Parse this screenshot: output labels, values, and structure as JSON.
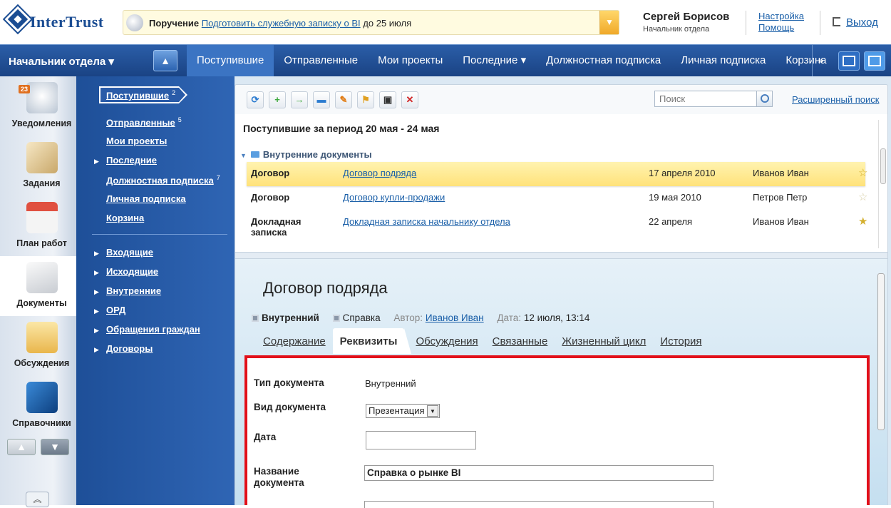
{
  "logo": {
    "text": "InterTrust"
  },
  "notice": {
    "prefix": "Поручение",
    "link": "Подготовить служебную записку о BI",
    "suffix": "до 25 июля"
  },
  "user": {
    "name": "Сергей Борисов",
    "role": "Начальник отдела"
  },
  "header_links": {
    "settings": "Настройка",
    "help": "Помощь",
    "logout": "Выход"
  },
  "nav": {
    "role_label": "Начальник отдела ▾",
    "tabs": [
      "Поступившие",
      "Отправленные",
      "Мои проекты",
      "Последние ▾",
      "Должностная подписка",
      "Личная подписка",
      "Корзина"
    ],
    "more": "»"
  },
  "dock": {
    "items": [
      {
        "label": "Уведомления",
        "icon": "megaphone-icon",
        "badge": "23"
      },
      {
        "label": "Задания",
        "icon": "tasks-icon"
      },
      {
        "label": "План работ",
        "icon": "calendar-clock-icon"
      },
      {
        "label": "Документы",
        "icon": "documents-icon"
      },
      {
        "label": "Обсуждения",
        "icon": "envelope-icon"
      },
      {
        "label": "Справочники",
        "icon": "directory-book-icon"
      }
    ]
  },
  "folders": {
    "current": {
      "label": "Поступившие",
      "count": "2"
    },
    "items": [
      {
        "label": "Отправленные",
        "count": "5"
      },
      {
        "label": "Мои проекты"
      },
      {
        "label": "Последние"
      },
      {
        "label": "Должностная подписка",
        "count": "7"
      },
      {
        "label": "Личная подписка"
      },
      {
        "label": "Корзина"
      }
    ],
    "tree": [
      "Входящие",
      "Исходящие",
      "Внутренние",
      "ОРД",
      "Обращения граждан",
      "Договоры"
    ]
  },
  "toolbar": {
    "search_placeholder": "Поиск",
    "advanced_search": "Расширенный поиск"
  },
  "list": {
    "period": "Поступившие за период 20 мая - 24 мая",
    "group": "Внутренние документы",
    "rows": [
      {
        "type": "Договор",
        "title": "Договор подряда",
        "date": "17 апреля 2010",
        "author": "Иванов Иван",
        "starred": true
      },
      {
        "type": "Договор",
        "title": "Договор купли-продажи",
        "date": "19 мая 2010",
        "author": "Петров Петр",
        "starred": false
      },
      {
        "type": "Докладная записка",
        "title": "Докладная записка начальнику отдела",
        "date": "22 апреля",
        "author": "Иванов Иван",
        "starred": true
      }
    ]
  },
  "detail": {
    "title": "Договор подряда",
    "tag1": "Внутренний",
    "tag2": "Справка",
    "author_label": "Автор:",
    "author": "Иванов Иван",
    "date_label": "Дата:",
    "date": "12 июля, 13:14",
    "tabs": [
      "Содержание",
      "Реквизиты",
      "Обсуждения",
      "Связанные",
      "Жизненный цикл",
      "История"
    ]
  },
  "form": {
    "doc_type_label": "Тип документа",
    "doc_type_value": "Внутренний",
    "doc_kind_label": "Вид документа",
    "doc_kind_value": "Презентация",
    "date_label": "Дата",
    "date_value": "",
    "name_label": "Название документа",
    "name_value": "Справка о рынке BI"
  }
}
